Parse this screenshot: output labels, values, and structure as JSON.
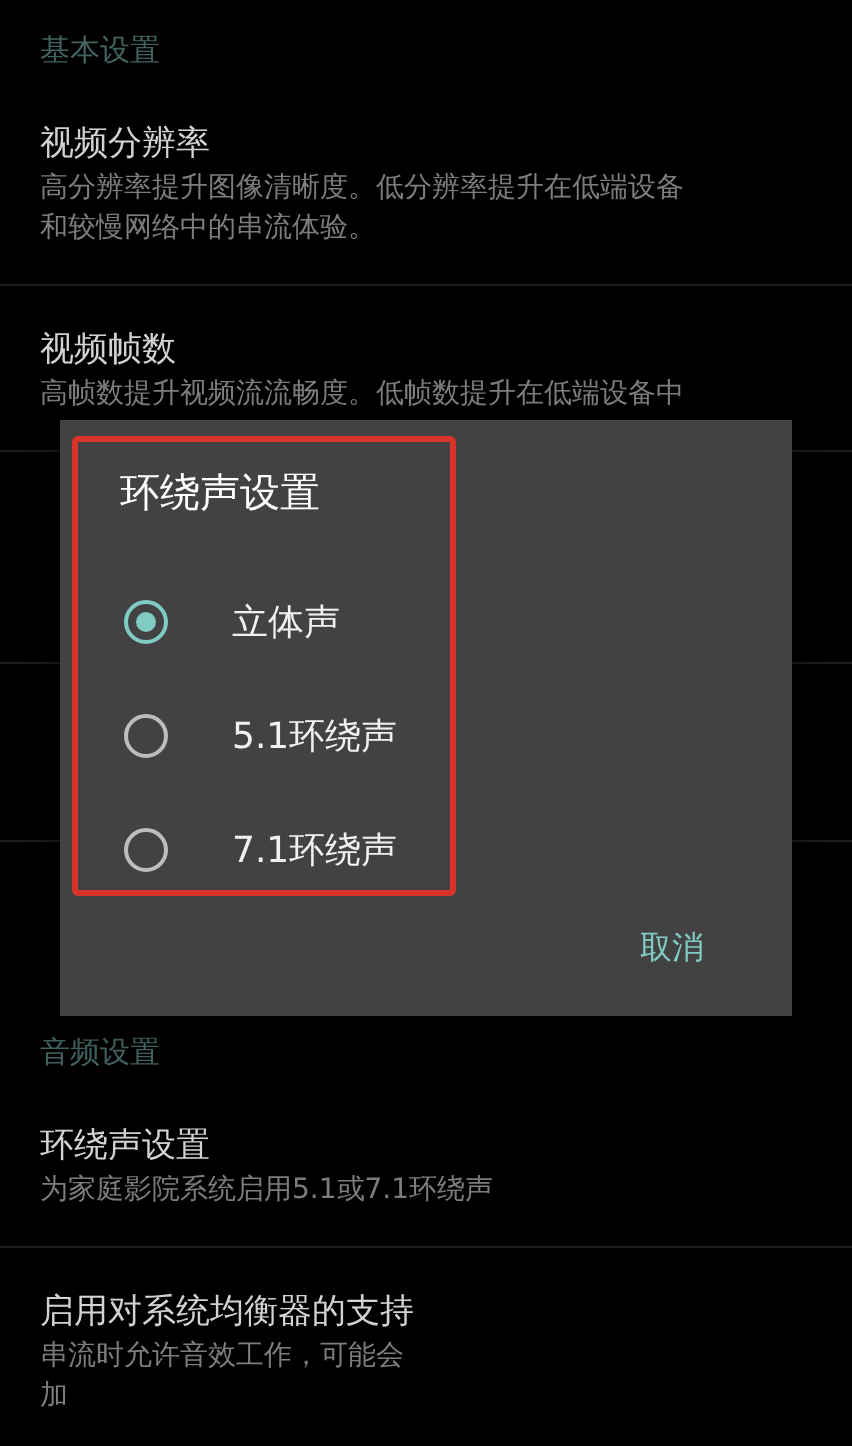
{
  "sections": [
    {
      "header": "基本设置",
      "items": [
        {
          "title": "视频分辨率",
          "description": [
            "高分辨率提升图像清晰度。低分辨率提升在低端设备",
            "和较慢网络中的串流体验。"
          ]
        },
        {
          "title": "视频帧数",
          "description": [
            "高帧数提升视频流流畅度。低帧数提升在低端设备中"
          ]
        }
      ]
    },
    {
      "header": "音频设置",
      "items": [
        {
          "title": "环绕声设置",
          "description": [
            "为家庭影院系统启用5.1或7.1环绕声"
          ]
        },
        {
          "title": "启用对系统均衡器的支持",
          "description": [
            "串流时允许音效工作，可能会",
            "加"
          ]
        }
      ]
    }
  ],
  "dialog": {
    "title": "环绕声设置",
    "options": [
      {
        "label": "立体声",
        "selected": true
      },
      {
        "label": "5.1环绕声",
        "selected": false
      },
      {
        "label": "7.1环绕声",
        "selected": false
      }
    ],
    "highlighted": true,
    "buttons": [
      "取消"
    ]
  }
}
